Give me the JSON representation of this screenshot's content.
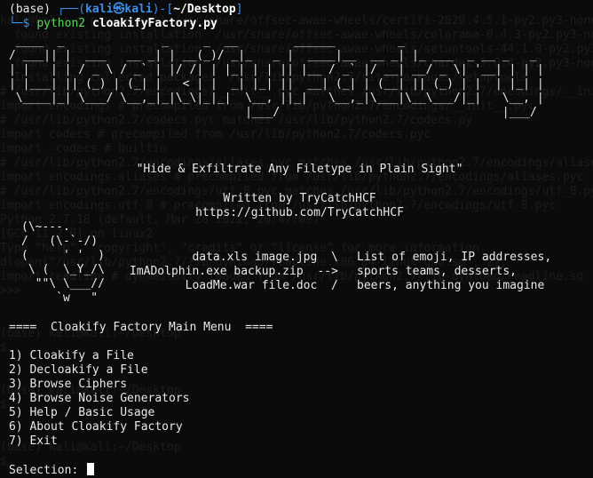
{
  "prompt": {
    "env": "(base)",
    "user_host": "kali㉿kali",
    "path": "~/Desktop",
    "command_bin": "python2",
    "command_arg": "cloakifyFactory.py"
  },
  "banner_ascii": " ____  _              _     _  __        ______         _                        \n/ ___|| |  ___   __ _| | __(_)/ _|_   _ |  ____|__  __ _| |_ ___  _ __ _   _    \n| |   | | / _ \\ / _` | |/ /| | |_| | | || |__ / _` |/ __| __/ _ \\| '__| | | |   \n| |___| || (_) | (_| |   < | |  _| |_| ||  __| (_| | (__| || (_) | |  | |_| |   \n \\____|_| \\___/ \\__,_|_|\\_\\|_|_|  \\__, ||_|   \\__,_|\\___|\\__\\___/|_|   \\__, |   \n                                  |___/                                |___/    ",
  "tagline": "\"Hide & Exfiltrate Any Filetype in Plain Sight\"",
  "written_by": "Written by TryCatchHCF",
  "url": "https://github.com/TryCatchHCF",
  "dolphin_art": "(\\~---.\n/   (\\-`-/)\n(     ' '  )\n \\ (  \\_Y_/\\\n  \"\"\\ \\___//\n     `w   \"",
  "files_col": "data.xls image.jpg  \\\nImADolphin.exe backup.zip  -->\nLoadMe.war file.doc  /",
  "desc_col": "List of emoji, IP addresses,\nsports teams, desserts,\nbeers, anything you imagine",
  "menu": {
    "title": "====  Cloakify Factory Main Menu  ====",
    "items": [
      "1) Cloakify a File",
      "2) Decloakify a File",
      "3) Browse Ciphers",
      "4) Browse Noise Generators",
      "5) Help / Basic Usage",
      "6) About Cloakify Factory",
      "7) Exit"
    ]
  },
  "selection_label": "Selection:"
}
